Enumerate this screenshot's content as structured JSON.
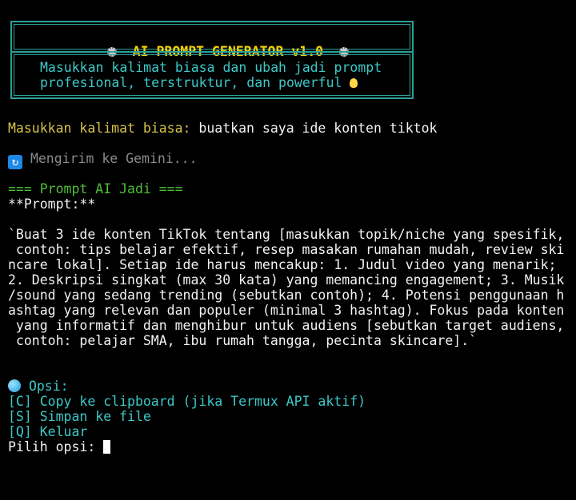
{
  "banner": {
    "title": "AI PROMPT GENERATOR v1.0",
    "subtitle_line1": "Masukkan kalimat biasa dan ubah jadi prompt",
    "subtitle_line2": "profesional, terstruktur, dan powerful"
  },
  "input": {
    "label": "Masukkan kalimat biasa:",
    "value": "buatkan saya ide konten tiktok"
  },
  "status": {
    "text": "Mengirim ke Gemini..."
  },
  "result": {
    "header": "=== Prompt AI Jadi ===",
    "prompt_label": "**Prompt:**",
    "lines": [
      "`Buat 3 ide konten TikTok tentang [masukkan topik/niche yang spesifik,",
      " contoh: tips belajar efektif, resep masakan rumahan mudah, review ski",
      "ncare lokal]. Setiap ide harus mencakup: 1. Judul video yang menarik;",
      "2. Deskripsi singkat (max 30 kata) yang memancing engagement; 3. Musik",
      "/sound yang sedang trending (sebutkan contoh); 4. Potensi penggunaan h",
      "ashtag yang relevan dan populer (minimal 3 hashtag). Fokus pada konten",
      " yang informatif dan menghibur untuk audiens [sebutkan target audiens,",
      " contoh: pelajar SMA, ibu rumah tangga, pecinta skincare].`"
    ]
  },
  "options": {
    "header": "Opsi:",
    "copy": "[C] Copy ke clipboard (jika Termux API aktif)",
    "save": "[S] Simpan ke file",
    "quit": "[Q] Keluar",
    "prompt": "Pilih opsi:"
  },
  "icons": {
    "banner_left": "gear-icon",
    "banner_right": "gear-icon",
    "subtitle_end": "lightbulb-icon",
    "status": "refresh-icon",
    "options": "blue-circle-icon"
  },
  "colors": {
    "border": "#2aa198",
    "title": "#f5d000",
    "accent": "#3fc8c8",
    "label": "#d6c44b",
    "header": "#4fbf3a",
    "muted": "#8a8a8a"
  }
}
